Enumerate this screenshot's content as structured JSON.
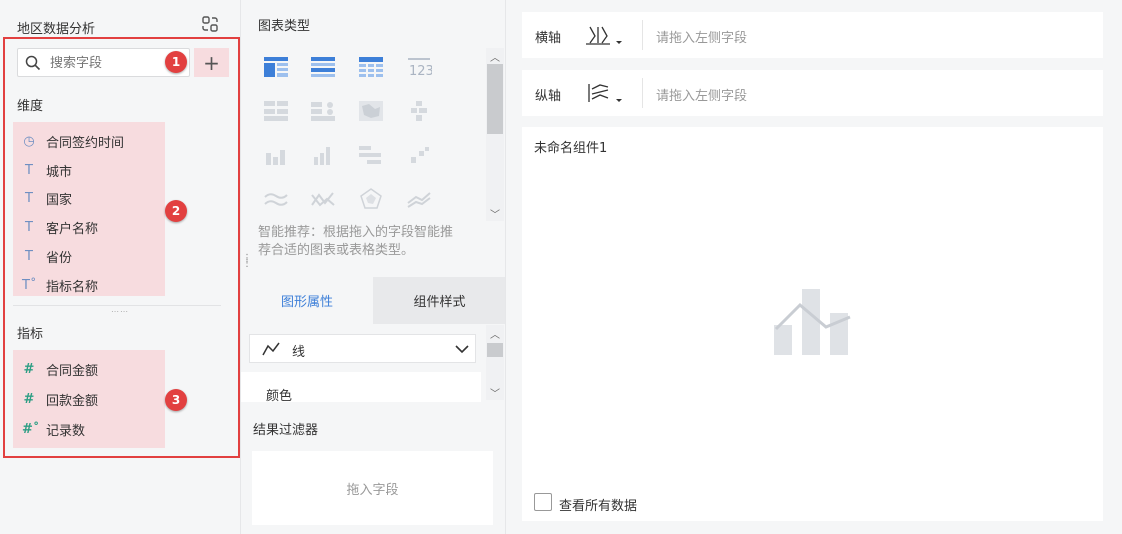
{
  "left": {
    "title": "地区数据分析",
    "search_placeholder": "搜索字段",
    "add_label": "+",
    "dimensions_title": "维度",
    "dimensions": [
      {
        "label": "合同签约时间",
        "icon": "clock-icon",
        "glyph": "◷"
      },
      {
        "label": "城市",
        "icon": "text-type-icon",
        "glyph": "T"
      },
      {
        "label": "国家",
        "icon": "text-type-icon",
        "glyph": "T"
      },
      {
        "label": "客户名称",
        "icon": "text-type-icon",
        "glyph": "T"
      },
      {
        "label": "省份",
        "icon": "text-type-icon",
        "glyph": "T"
      },
      {
        "label": "指标名称",
        "icon": "text-type-computed-icon",
        "glyph": "T˚"
      }
    ],
    "measures_title": "指标",
    "measures": [
      {
        "label": "合同金额",
        "icon": "number-type-icon",
        "glyph": "#"
      },
      {
        "label": "回款金额",
        "icon": "number-type-icon",
        "glyph": "#"
      },
      {
        "label": "记录数",
        "icon": "number-type-computed-icon",
        "glyph": "#˚"
      }
    ],
    "badges": [
      "1",
      "2",
      "3"
    ]
  },
  "mid": {
    "chart_type_title": "图表类型",
    "recommend_text_1": "智能推荐：根据拖入的字段智能推",
    "recommend_text_2": "荐合适的图表或表格类型。",
    "tab_graphic": "图形属性",
    "tab_component_style": "组件样式",
    "line_select": "线",
    "color_label": "颜色",
    "filter_title": "结果过滤器",
    "filter_drop": "拖入字段"
  },
  "right": {
    "x_axis_label": "横轴",
    "x_axis_placeholder": "请拖入左侧字段",
    "y_axis_label": "纵轴",
    "y_axis_placeholder": "请拖入左侧字段",
    "component_name": "未命名组件1",
    "view_all_data": "查看所有数据"
  },
  "colors": {
    "highlight": "#f7dcdf",
    "annotation_red": "#e24040",
    "accent_blue": "#3d7fd8"
  }
}
